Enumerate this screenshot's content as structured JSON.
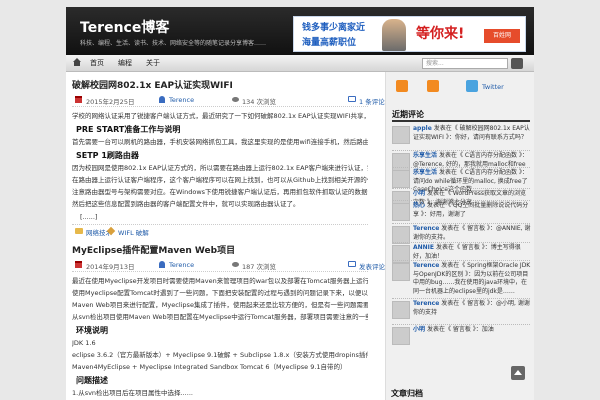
{
  "site": {
    "title": "Terence博客",
    "desc": "科技、编程、生活、读书、技术、网络安全等的随笔记录分享博客……"
  },
  "banner": {
    "line1": "钱多事少离家近",
    "line2": "海量高薪职位",
    "wait": "等你来!",
    "logo": "百姓网"
  },
  "nav": {
    "items": [
      "首页",
      "编程",
      "关于"
    ],
    "search_placeholder": "搜索..."
  },
  "posts": [
    {
      "title": "破解校园网802.1x EAP认证实现WIFI",
      "date": "2015年2月25日",
      "author": "Terence",
      "views": "134 次浏览",
      "comments": "1 条评论",
      "p1": "学校的网络认证采用了锐捷客户端认证方式，最近研究了一下如何破解802.1x EAP认证实现WIFI共享，这里把破解的过程以及遇到的问题分享记录下来。",
      "h1": "PRE START准备工作与说明",
      "p2": "首先需要一台可以刷机的路由器，手机安装网络抓包工具，我这里实现的是使用wifi连接手机，然后路由器认证后共享网络给手机等设备使用，",
      "p2_tail": "。",
      "h2": "SETP 1刷路由器",
      "p3": "因为校园网是使用802.1x EAP认证方式的，所以需要在路由器上运行802.1x EAP客户端来进行认证，实现WIFI共享，刷入openwrt固件，然后",
      "p4": "在路由器上运行认证客户端程序，这个客户端程序可以在网上找到，也可以从Github上找到相关开源的代码自己编译，ipk安装包可以从jailbreak获取，",
      "p5": "注意路由器型号与架构需要对应。在Windows下使用锐捷客户端认证后，再用抓包软件抓取认证的数据包，分析数据包中的用户名和密码等信息，",
      "p6": "然后把这些信息配置到路由器的客户端配置文件中，就可以实现路由器认证了。",
      "more": "[......]",
      "category": "网络技术",
      "tags": "WIFL 破解"
    },
    {
      "title": "MyEclipse插件配置Maven Web项目",
      "date": "2014年9月13日",
      "author": "Terence",
      "views": "187 次浏览",
      "comments": "发表评论",
      "p1": "最近在使用Myeclipse开发项目时需要使用Maven来管理项目的war包以及部署在Tomcat服务器上运行的webapp项目，但是在",
      "p2": "使用Myeclipse配置Tomcat时遇到了一些问题，下面把安装配置的过程与遇到的问题记录下来，以便以后遇到同样问题时可以参考。在Myeclipse下的配置可以使用",
      "p3": "Maven Web项目来进行配置，Myeclipse集成了插件，使用起来还是比较方便的，但是有一些问题需要注意，下面详细介绍配置方法与步骤。",
      "p4": "从svn检出项目使用Maven Web项目配置在Myeclipse中运行Tomcat服务器，部署项目需要注意的一些问题。",
      "h1": "环境说明",
      "env1": "JDK 1.6",
      "env2": "eclipse 3.6.2（官方最新版本）+ Myeclipse 9.1破解 + Subclipse 1.8.x（安装方式使用dropins插件方式）",
      "env3": "Maven4MyEclipse + Myeclipse Integrated Sandbox Tomcat 6（Myeclipse 9.1自带的）",
      "h2": "问题描述",
      "p5": "1.从svn检出项目后在项目属性中选择......"
    }
  ],
  "sidebar": {
    "rss": "",
    "mail": "",
    "twitter": "Twitter",
    "recent_comments_title": "近期评论",
    "comments": [
      {
        "name": "apple",
        "text": "发表在《 破解校园网802.1x EAP认证实现WIFI 》：你好，请问有联系方式吗？"
      },
      {
        "name": "乐享生活",
        "text": "发表在《 C语言内存分配函数 》：@Terence, 好的，那我就用malloc和free了"
      },
      {
        "name": "乐享生活",
        "text": "发表在《 C语言内存分配函数 》：请问do while循环里的malloc, 换成free了 CaseChoice这个函数……"
      },
      {
        "name": "小明",
        "text": "发表在《 WordPress获取文章的浏览次数 》：谢谢博主分享"
      },
      {
        "name": "热心",
        "text": "发表在《 QQ空间批量删除说说代码分享 》：好用，谢谢了"
      },
      {
        "name": "Terence",
        "text": "发表在《 留言板 》：@ANNIE, 谢谢你的支持。"
      },
      {
        "name": "ANNIE",
        "text": "发表在《 留言板 》：博主写得很好，加油！"
      },
      {
        "name": "Terence",
        "text": "发表在《 Spring框架Oracle JDK与OpenJDK的区别 》：因为以前在公司项目中用的bug……我在使用的java环境中，在同一台机器上的eclipse里的jdk是……"
      },
      {
        "name": "Terence",
        "text": "发表在《 留言板 》：@小明, 谢谢你的支持"
      },
      {
        "name": "小明",
        "text": "发表在《 留言板 》：加油"
      }
    ],
    "bottom_title": "文章归档"
  },
  "colors": {
    "accent": "#1e5aa8",
    "header": "#1a1a1a",
    "rss": "#f28a20"
  }
}
